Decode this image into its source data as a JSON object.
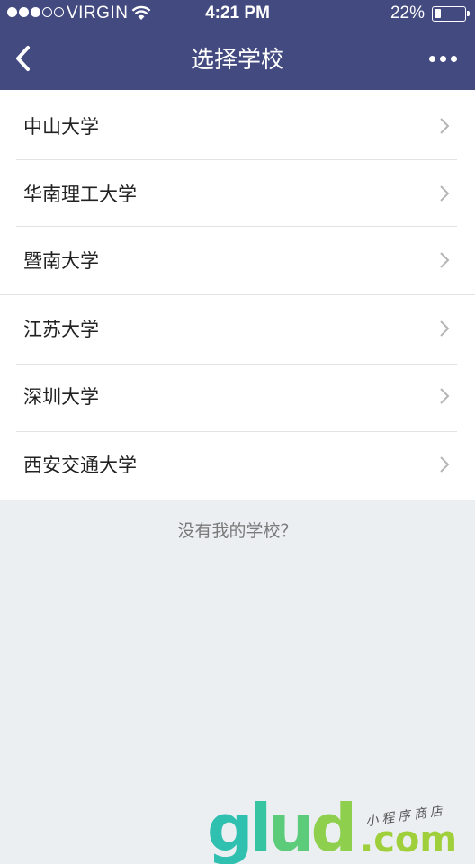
{
  "status_bar": {
    "carrier": "VIRGIN",
    "time": "4:21 PM",
    "battery_percent": "22%",
    "battery_level": 0.22
  },
  "nav": {
    "title": "选择学校",
    "back_icon": "chevron-left-icon",
    "more_icon": "more-dots-icon"
  },
  "schools": [
    {
      "name": "中山大学"
    },
    {
      "name": "华南理工大学"
    },
    {
      "name": "暨南大学"
    },
    {
      "name": "江苏大学"
    },
    {
      "name": "深圳大学"
    },
    {
      "name": "西安交通大学"
    }
  ],
  "missing_school_link": "没有我的学校？",
  "watermark": {
    "logo_text": "glud",
    "domain_suffix": ".com",
    "tagline": "小程序商店"
  },
  "colors": {
    "nav_bg": "#434a80",
    "page_bg": "#ebeff2",
    "list_bg": "#ffffff",
    "chevron": "#b5b5b5"
  }
}
